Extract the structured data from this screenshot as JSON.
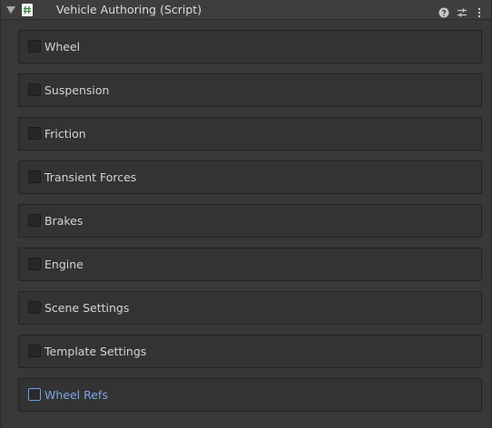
{
  "component": {
    "title": "Vehicle Authoring (Script)",
    "icons": {
      "foldout": "chevron-down-icon",
      "script": "script-hash-icon",
      "help": "help-icon",
      "presets": "sliders-icon",
      "menu": "kebab-menu-icon"
    }
  },
  "sections": [
    {
      "label": "Wheel",
      "checked": false,
      "focused": false
    },
    {
      "label": "Suspension",
      "checked": false,
      "focused": false
    },
    {
      "label": "Friction",
      "checked": false,
      "focused": false
    },
    {
      "label": "Transient Forces",
      "checked": false,
      "focused": false
    },
    {
      "label": "Brakes",
      "checked": false,
      "focused": false
    },
    {
      "label": "Engine",
      "checked": false,
      "focused": false
    },
    {
      "label": "Scene Settings",
      "checked": false,
      "focused": false
    },
    {
      "label": "Template Settings",
      "checked": false,
      "focused": false
    },
    {
      "label": "Wheel Refs",
      "checked": false,
      "focused": true
    }
  ],
  "colors": {
    "focus_accent": "#7ba7e4"
  }
}
